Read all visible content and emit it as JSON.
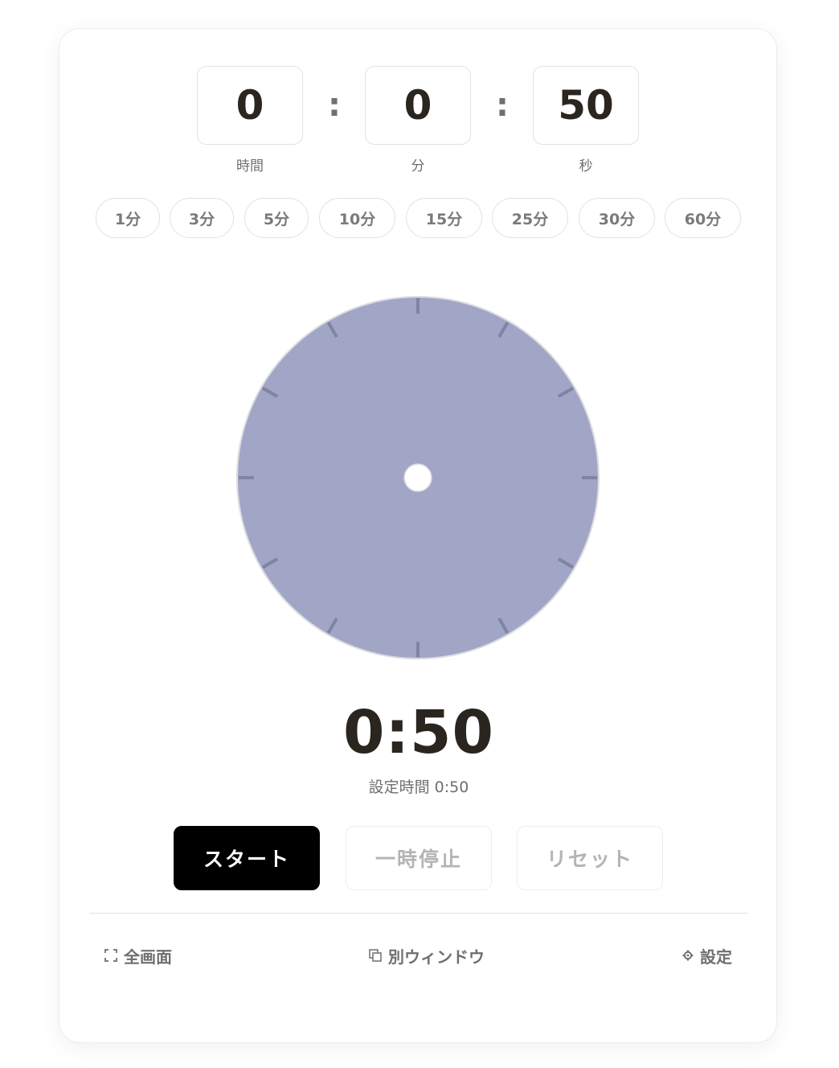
{
  "time_inputs": {
    "hours": {
      "value": "0",
      "label": "時間"
    },
    "minutes": {
      "value": "0",
      "label": "分"
    },
    "seconds": {
      "value": "50",
      "label": "秒"
    },
    "separator": ":"
  },
  "presets": [
    "1分",
    "3分",
    "5分",
    "10分",
    "15分",
    "25分",
    "30分",
    "60分"
  ],
  "dial": {
    "remaining_fraction": 1.0,
    "fill_color": "#a1a5c6",
    "tick_color": "#7f84a3",
    "ring_color": "#dcdcdf",
    "tick_count": 12
  },
  "display": {
    "remaining": "0:50",
    "set_time_label": "設定時間 0:50"
  },
  "controls": {
    "start_label": "スタート",
    "pause_label": "一時停止",
    "reset_label": "リセット"
  },
  "footer": {
    "fullscreen_label": "全画面",
    "new_window_label": "別ウィンドウ",
    "settings_label": "設定",
    "fullscreen_icon": "fullscreen-icon",
    "new_window_icon": "new-window-icon",
    "settings_icon": "gear-icon"
  }
}
